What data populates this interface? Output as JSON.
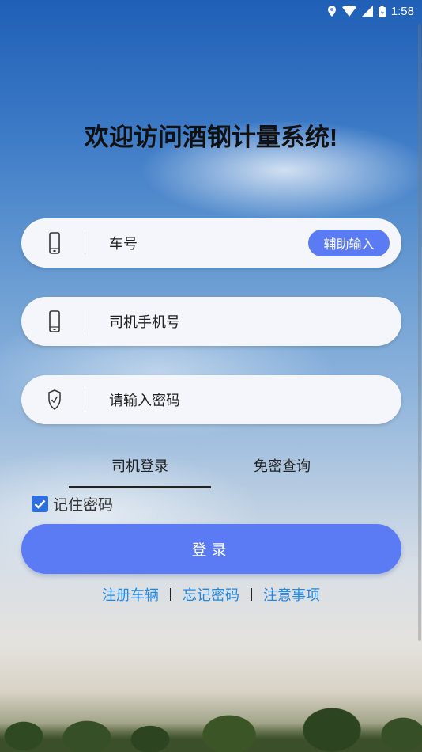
{
  "status_bar": {
    "time": "1:58"
  },
  "title": "欢迎访问酒钢计量系统!",
  "fields": {
    "plate": {
      "placeholder": "车号",
      "assist_button": "辅助输入"
    },
    "phone": {
      "placeholder": "司机手机号"
    },
    "password": {
      "placeholder": "请输入密码"
    }
  },
  "tabs": [
    {
      "label": "司机登录",
      "active": true
    },
    {
      "label": "免密查询",
      "active": false
    }
  ],
  "remember": {
    "label": "记住密码",
    "checked": true
  },
  "login_button": "登录",
  "links": [
    "注册车辆",
    "忘记密码",
    "注意事项"
  ],
  "colors": {
    "accent": "#5b7bf5",
    "link": "#1e88e5",
    "checkbox": "#2e6fdd"
  }
}
